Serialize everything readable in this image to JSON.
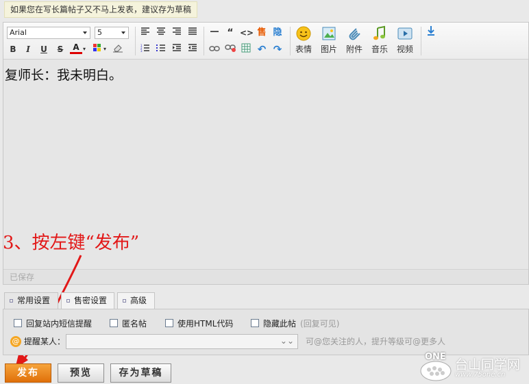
{
  "tip": "如果您在写长篇帖子又不马上发表，建议存为草稿",
  "toolbar": {
    "font_family": "Arial",
    "font_size": "5",
    "bold": "B",
    "italic": "I",
    "underline": "U",
    "strike": "S",
    "font_color": "A",
    "buttons": [
      {
        "label": "表情"
      },
      {
        "label": "图片"
      },
      {
        "label": "附件"
      },
      {
        "label": "音乐"
      },
      {
        "label": "视频"
      }
    ]
  },
  "editor": {
    "content": "复师长：我未明白。",
    "status": "已保存"
  },
  "annotation": "3、按左键“发布”",
  "tabs": [
    {
      "label": "常用设置"
    },
    {
      "label": "售密设置"
    },
    {
      "label": "高级"
    }
  ],
  "options": {
    "sms_reply": "回复站内短信提醒",
    "anonymous": "匿名帖",
    "html_code": "使用HTML代码",
    "hide_post": "隐藏此帖",
    "hide_post_hint": "(回复可见)"
  },
  "mention": {
    "label": "提醒某人：",
    "hint": "可@您关注的人，提升等级可@更多人"
  },
  "actions": {
    "publish": "发布",
    "preview": "预览",
    "save_draft": "存为草稿"
  },
  "watermark": {
    "logo": "ONE",
    "title": "台山同学网",
    "url": "www.75one.cn"
  },
  "colors": {
    "annotation": "#e21818",
    "publish_button": "#e88218"
  }
}
